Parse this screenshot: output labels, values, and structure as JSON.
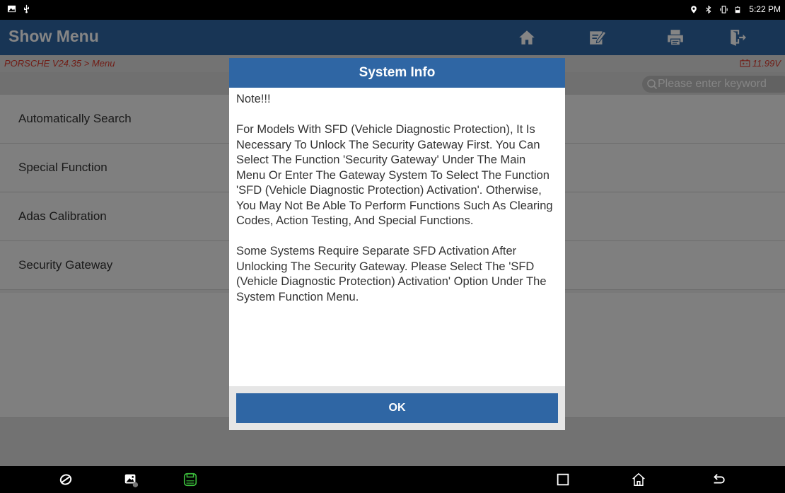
{
  "status_bar": {
    "time": "5:22 PM",
    "left_icons": [
      "image-icon",
      "usb-icon"
    ],
    "right_icons": [
      "location-icon",
      "bluetooth-icon",
      "vibrate-icon",
      "battery-icon"
    ]
  },
  "header": {
    "title": "Show Menu",
    "buttons": [
      "home-icon",
      "edit-icon",
      "print-icon",
      "exit-icon"
    ],
    "color": "#2f66a4"
  },
  "breadcrumb": {
    "path": "PORSCHE V24.35 > Menu",
    "voltage": "11.99V",
    "color": "#d8392b"
  },
  "search": {
    "placeholder": "Please enter keyword"
  },
  "menu": {
    "items": [
      {
        "label": "Automatically Search"
      },
      {
        "label": "Special Function"
      },
      {
        "label": "Adas Calibration"
      },
      {
        "label": "Security Gateway"
      }
    ]
  },
  "dialog": {
    "title": "System Info",
    "body": "Note!!!\n\nFor Models With SFD (Vehicle Diagnostic Protection), It Is Necessary To Unlock The Security Gateway First. You Can Select The Function 'Security Gateway' Under The Main Menu Or Enter The Gateway System To Select The Function 'SFD (Vehicle Diagnostic Protection) Activation'. Otherwise, You May Not Be Able To Perform Functions Such As Clearing Codes, Action Testing, And Special Functions.\n\nSome Systems Require Separate SFD Activation After Unlocking The Security Gateway. Please Select The 'SFD (Vehicle Diagnostic Protection) Activation' Option Under The System Function Menu.",
    "ok_label": "OK"
  },
  "navbar": {
    "left": [
      "browser-icon",
      "gallery-icon",
      "vci-icon"
    ],
    "right": [
      "recents-icon",
      "home-nav-icon",
      "back-icon"
    ]
  }
}
